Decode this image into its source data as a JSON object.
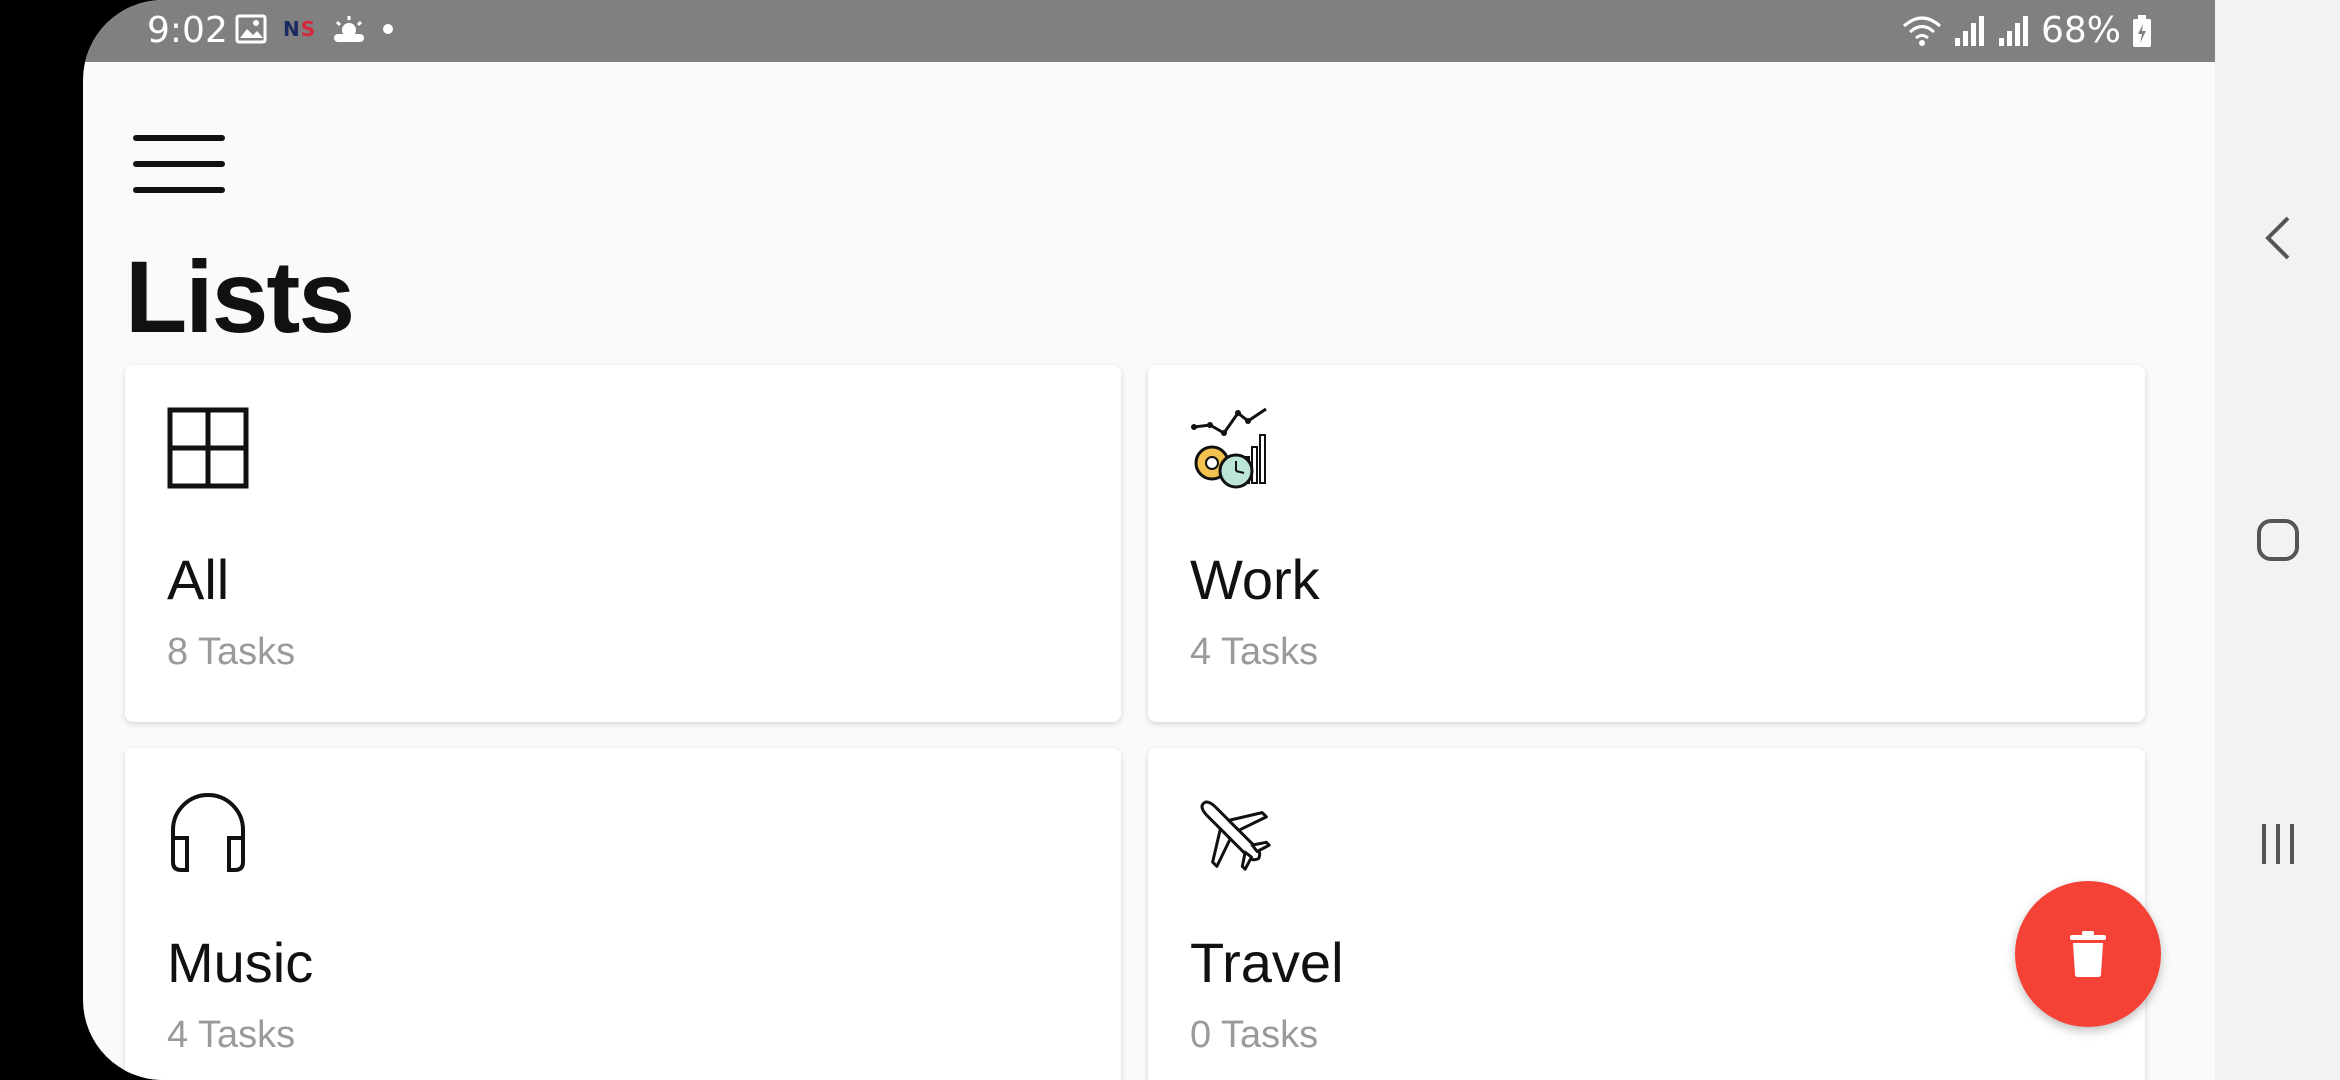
{
  "status_bar": {
    "time": "9:02",
    "battery": "68%",
    "ns_logo": "NS",
    "icons": [
      "image-icon",
      "ns-logo",
      "weather-icon",
      "dot-icon",
      "wifi-icon",
      "signal-icon",
      "signal-icon",
      "battery-icon"
    ]
  },
  "header": {
    "menu_icon": "hamburger-menu-icon",
    "title": "Lists"
  },
  "lists": [
    {
      "name": "All",
      "count": "8 Tasks",
      "icon": "grid-icon"
    },
    {
      "name": "Work",
      "count": "4 Tasks",
      "icon": "work-analytics-icon"
    },
    {
      "name": "Music",
      "count": "4 Tasks",
      "icon": "headphones-icon"
    },
    {
      "name": "Travel",
      "count": "0 Tasks",
      "icon": "airplane-icon"
    }
  ],
  "fab": {
    "icon": "trash-icon",
    "color": "#f44336"
  },
  "system_nav": {
    "back_icon": "back-icon",
    "home_icon": "home-icon",
    "recents_icon": "recents-icon"
  }
}
